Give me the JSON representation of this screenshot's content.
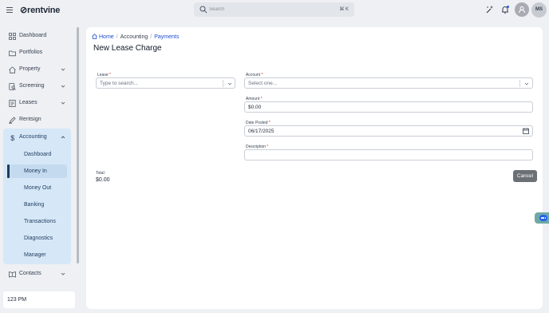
{
  "app": {
    "logo": "rentvine",
    "logo_mark": "⊘"
  },
  "topbar": {
    "search_placeholder": "Search",
    "search_shortcut": "⌘ K",
    "user_initials": "MS"
  },
  "sidebar": {
    "items": [
      {
        "label": "Dashboard",
        "icon": "grid-icon"
      },
      {
        "label": "Portfolios",
        "icon": "folder-icon"
      },
      {
        "label": "Property",
        "icon": "home-icon"
      },
      {
        "label": "Screening",
        "icon": "document-search-icon"
      },
      {
        "label": "Leases",
        "icon": "file-icon"
      },
      {
        "label": "Rentsign",
        "icon": "pen-icon"
      },
      {
        "label": "Accounting",
        "icon": "dollar-icon"
      },
      {
        "label": "Contacts",
        "icon": "address-book-icon"
      }
    ],
    "accounting_sub": [
      {
        "label": "Dashboard"
      },
      {
        "label": "Money In"
      },
      {
        "label": "Money Out"
      },
      {
        "label": "Banking"
      },
      {
        "label": "Transactions"
      },
      {
        "label": "Diagnostics"
      },
      {
        "label": "Manager"
      }
    ],
    "time_label": "123 PM"
  },
  "breadcrumb": {
    "home": "Home",
    "section": "Accounting",
    "page": "Payments"
  },
  "page": {
    "title": "New Lease Charge"
  },
  "form": {
    "lease": {
      "label": "Lease",
      "placeholder": "Type to search..."
    },
    "account": {
      "label": "Account",
      "placeholder": "Select one..."
    },
    "amount": {
      "label": "Amount",
      "value": "$0.00"
    },
    "date_posted": {
      "label": "Date Posted",
      "value": "06/17/2025"
    },
    "description": {
      "label": "Description",
      "value": ""
    },
    "required_mark": "*"
  },
  "total": {
    "label": "Total:",
    "value": "$0.00"
  },
  "actions": {
    "cancel": "Cancel"
  },
  "colors": {
    "accent": "#1d4ed8",
    "sidebar_active": "#d6e8f7",
    "cancel_bg": "#6b7075"
  }
}
